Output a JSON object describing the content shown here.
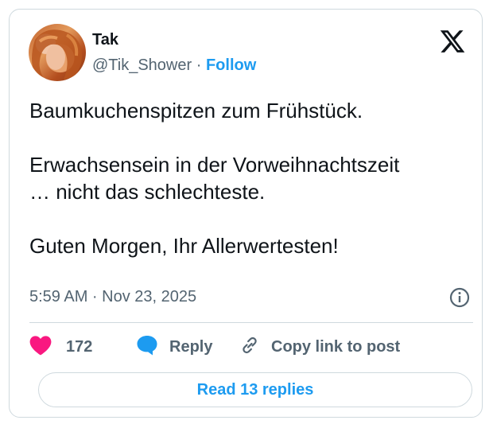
{
  "author": {
    "name": "Tak",
    "handle": "@Tik_Shower",
    "separator": "·",
    "follow_label": "Follow"
  },
  "tweet": {
    "lines": [
      "Baumkuchenspitzen zum Frühstück.",
      "Erwachsensein in der Vorweihnachtszeit",
      "… nicht das schlechteste.",
      "Guten Morgen, Ihr Allerwertesten!"
    ],
    "timestamp": "5:59 AM · Nov 23, 2025"
  },
  "actions": {
    "like_count": "172",
    "reply_label": "Reply",
    "copy_label": "Copy link to post"
  },
  "read_replies_label": "Read 13 replies",
  "colors": {
    "accent": "#1d9bf0",
    "like": "#f91880",
    "text": "#0f1419",
    "muted": "#536471",
    "border": "#cfd9de"
  },
  "icons": [
    "x-logo-icon",
    "info-icon",
    "heart-icon",
    "reply-bubble-icon",
    "link-icon"
  ]
}
